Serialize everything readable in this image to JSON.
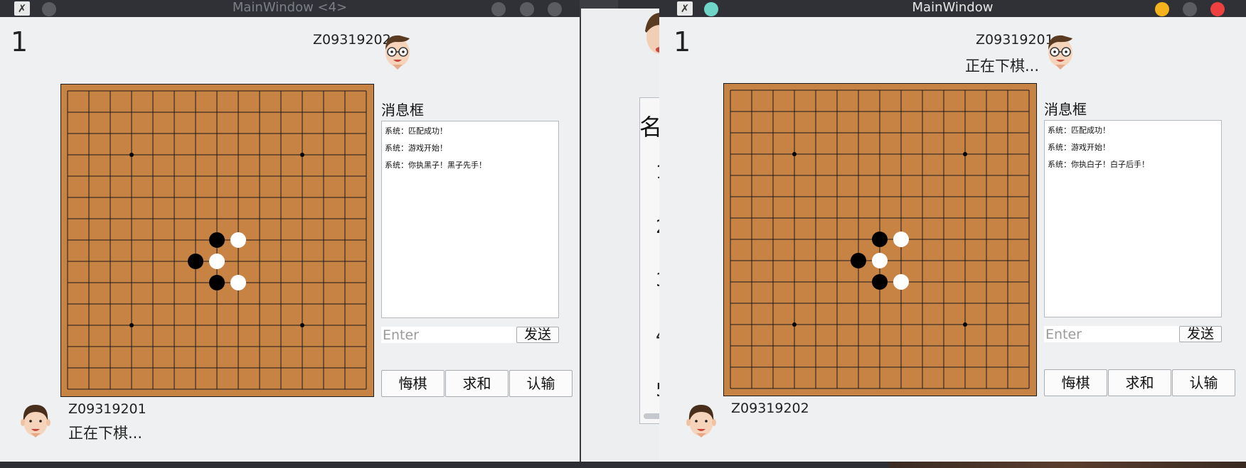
{
  "left_window": {
    "title": "MainWindow <4>",
    "round": "1",
    "opponent": {
      "name": "Z09319202",
      "status": ""
    },
    "self": {
      "name": "Z09319201",
      "status": "正在下棋..."
    },
    "message_label": "消息框",
    "messages": [
      "系统：匹配成功！",
      "系统：游戏开始！",
      "系统：你执黑子！黑子先手！"
    ],
    "input_placeholder": "Enter",
    "send_label": "发送",
    "buttons": [
      "悔棋",
      "求和",
      "认输"
    ]
  },
  "right_window": {
    "title": "MainWindow",
    "round": "1",
    "opponent": {
      "name": "Z09319201",
      "status": "正在下棋..."
    },
    "self": {
      "name": "Z09319202",
      "status": ""
    },
    "message_label": "消息框",
    "messages": [
      "系统：匹配成功！",
      "系统：游戏开始！",
      "系统：你执白子！白子后手！"
    ],
    "input_placeholder": "Enter",
    "send_label": "发送",
    "buttons": [
      "悔棋",
      "求和",
      "认输"
    ]
  },
  "background_window": {
    "heading": "名",
    "numbers": [
      "1",
      "2",
      "3",
      "4",
      "5"
    ]
  },
  "board": {
    "size": 15,
    "star_points": [
      [
        3,
        3
      ],
      [
        11,
        3
      ],
      [
        3,
        11
      ],
      [
        11,
        11
      ]
    ],
    "stones": [
      {
        "col": 7,
        "row": 7,
        "color": "black"
      },
      {
        "col": 8,
        "row": 7,
        "color": "white"
      },
      {
        "col": 6,
        "row": 8,
        "color": "black"
      },
      {
        "col": 7,
        "row": 8,
        "color": "white"
      },
      {
        "col": 7,
        "row": 9,
        "color": "black"
      },
      {
        "col": 8,
        "row": 9,
        "color": "white"
      }
    ]
  },
  "colors": {
    "board": "#c68344",
    "black_stone": "#000000",
    "white_stone": "#ffffff",
    "titlebar": "#2f3136",
    "dot_yellow": "#f5b21c",
    "dot_red": "#ee4040",
    "dot_teal": "#6fd5c8"
  }
}
